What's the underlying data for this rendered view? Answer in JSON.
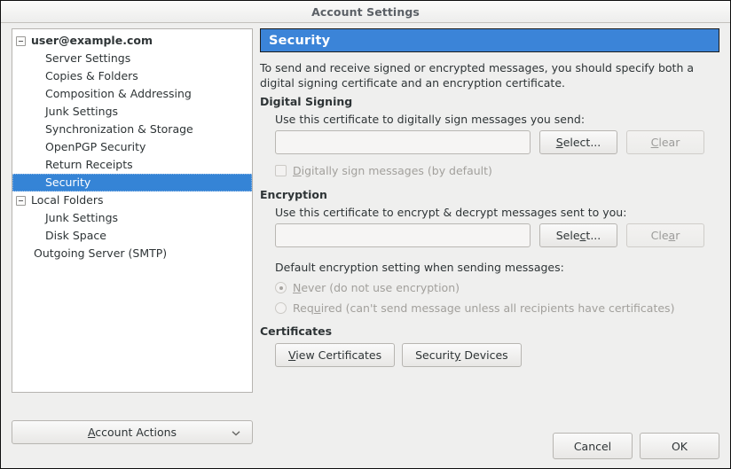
{
  "window": {
    "title": "Account Settings"
  },
  "sidebar": {
    "items": [
      {
        "label": "user@example.com",
        "level": 0,
        "expander": true,
        "bold": true,
        "selected": false
      },
      {
        "label": "Server Settings",
        "level": 1,
        "expander": false,
        "bold": false,
        "selected": false
      },
      {
        "label": "Copies & Folders",
        "level": 1,
        "expander": false,
        "bold": false,
        "selected": false
      },
      {
        "label": "Composition & Addressing",
        "level": 1,
        "expander": false,
        "bold": false,
        "selected": false
      },
      {
        "label": "Junk Settings",
        "level": 1,
        "expander": false,
        "bold": false,
        "selected": false
      },
      {
        "label": "Synchronization & Storage",
        "level": 1,
        "expander": false,
        "bold": false,
        "selected": false
      },
      {
        "label": "OpenPGP Security",
        "level": 1,
        "expander": false,
        "bold": false,
        "selected": false
      },
      {
        "label": "Return Receipts",
        "level": 1,
        "expander": false,
        "bold": false,
        "selected": false
      },
      {
        "label": "Security",
        "level": 1,
        "expander": false,
        "bold": false,
        "selected": true
      },
      {
        "label": "Local Folders",
        "level": 0,
        "expander": true,
        "bold": false,
        "selected": false
      },
      {
        "label": "Junk Settings",
        "level": 1,
        "expander": false,
        "bold": false,
        "selected": false
      },
      {
        "label": "Disk Space",
        "level": 1,
        "expander": false,
        "bold": false,
        "selected": false
      },
      {
        "label": "Outgoing Server (SMTP)",
        "level": 2,
        "expander": false,
        "bold": false,
        "selected": false
      }
    ],
    "account_actions": {
      "label": "Account Actions",
      "accesskey": "A",
      "icon": "chevron-down-icon"
    }
  },
  "page": {
    "header": "Security",
    "intro": "To send and receive signed or encrypted messages, you should specify both a digital signing certificate and an encryption certificate.",
    "digital_signing": {
      "title": "Digital Signing",
      "field_label": "Use this certificate to digitally sign messages you send:",
      "certificate_value": "",
      "select_button": {
        "label": "Select...",
        "accesskey": "S",
        "disabled": false
      },
      "clear_button": {
        "label": "Clear",
        "accesskey": "C",
        "disabled": true
      },
      "checkbox": {
        "label": "Digitally sign messages (by default)",
        "accesskey": "D",
        "checked": false,
        "disabled": true
      }
    },
    "encryption": {
      "title": "Encryption",
      "field_label": "Use this certificate to encrypt & decrypt messages sent to you:",
      "certificate_value": "",
      "select_button": {
        "label": "Select...",
        "accesskey": "c",
        "disabled": false
      },
      "clear_button": {
        "label": "Clear",
        "accesskey": "a",
        "disabled": true
      },
      "default_label": "Default encryption setting when sending messages:",
      "options": [
        {
          "label": "Never (do not use encryption)",
          "accesskey": "N",
          "selected": true,
          "disabled": true
        },
        {
          "label": "Required (can't send message unless all recipients have certificates)",
          "accesskey": "u",
          "selected": false,
          "disabled": true
        }
      ]
    },
    "certificates": {
      "title": "Certificates",
      "view_button": {
        "label": "View Certificates",
        "accesskey": "V"
      },
      "devices_button": {
        "label": "Security Devices",
        "accesskey": "y"
      }
    }
  },
  "dialog_buttons": {
    "cancel": "Cancel",
    "ok": "OK"
  },
  "colors": {
    "selection": "#3584d6",
    "header": "#3b84d8",
    "window_bg": "#efefee",
    "text": "#2e3436",
    "disabled_text": "#a2a09c"
  }
}
